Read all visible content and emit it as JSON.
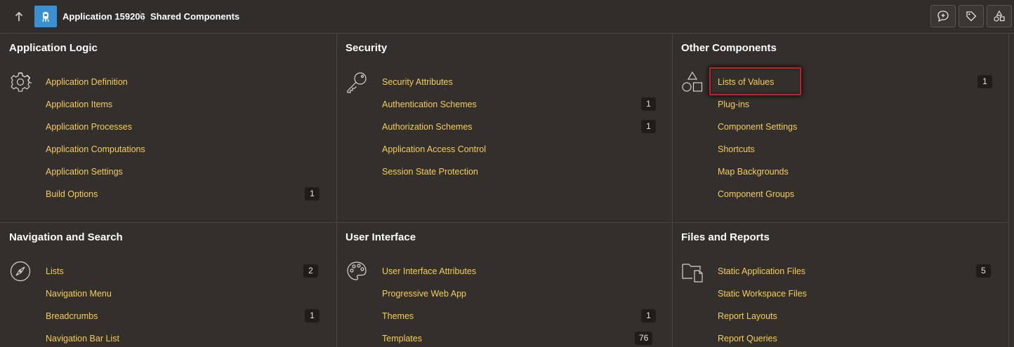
{
  "header": {
    "app_name": "Application 159206",
    "page_name": "Shared Components"
  },
  "panels": [
    {
      "title": "Application Logic",
      "icon": "gear-icon",
      "items": [
        {
          "label": "Application Definition",
          "count": ""
        },
        {
          "label": "Application Items",
          "count": ""
        },
        {
          "label": "Application Processes",
          "count": ""
        },
        {
          "label": "Application Computations",
          "count": ""
        },
        {
          "label": "Application Settings",
          "count": ""
        },
        {
          "label": "Build Options",
          "count": "1"
        }
      ]
    },
    {
      "title": "Security",
      "icon": "key-icon",
      "items": [
        {
          "label": "Security Attributes",
          "count": ""
        },
        {
          "label": "Authentication Schemes",
          "count": "1"
        },
        {
          "label": "Authorization Schemes",
          "count": "1"
        },
        {
          "label": "Application Access Control",
          "count": ""
        },
        {
          "label": "Session State Protection",
          "count": ""
        }
      ]
    },
    {
      "title": "Other Components",
      "icon": "shapes-icon",
      "items": [
        {
          "label": "Lists of Values",
          "count": "1"
        },
        {
          "label": "Plug-ins",
          "count": ""
        },
        {
          "label": "Component Settings",
          "count": ""
        },
        {
          "label": "Shortcuts",
          "count": ""
        },
        {
          "label": "Map Backgrounds",
          "count": ""
        },
        {
          "label": "Component Groups",
          "count": ""
        }
      ]
    },
    {
      "title": "Navigation and Search",
      "icon": "compass-icon",
      "items": [
        {
          "label": "Lists",
          "count": "2"
        },
        {
          "label": "Navigation Menu",
          "count": ""
        },
        {
          "label": "Breadcrumbs",
          "count": "1"
        },
        {
          "label": "Navigation Bar List",
          "count": ""
        }
      ]
    },
    {
      "title": "User Interface",
      "icon": "palette-icon",
      "items": [
        {
          "label": "User Interface Attributes",
          "count": ""
        },
        {
          "label": "Progressive Web App",
          "count": ""
        },
        {
          "label": "Themes",
          "count": "1"
        },
        {
          "label": "Templates",
          "count": "76"
        }
      ]
    },
    {
      "title": "Files and Reports",
      "icon": "folder-file-icon",
      "items": [
        {
          "label": "Static Application Files",
          "count": "5"
        },
        {
          "label": "Static Workspace Files",
          "count": ""
        },
        {
          "label": "Report Layouts",
          "count": ""
        },
        {
          "label": "Report Queries",
          "count": ""
        }
      ]
    }
  ],
  "colors": {
    "background": "#332f2c",
    "link": "#f7cd56",
    "app_icon": "#3a91d2",
    "highlight_border": "#c3202a"
  }
}
